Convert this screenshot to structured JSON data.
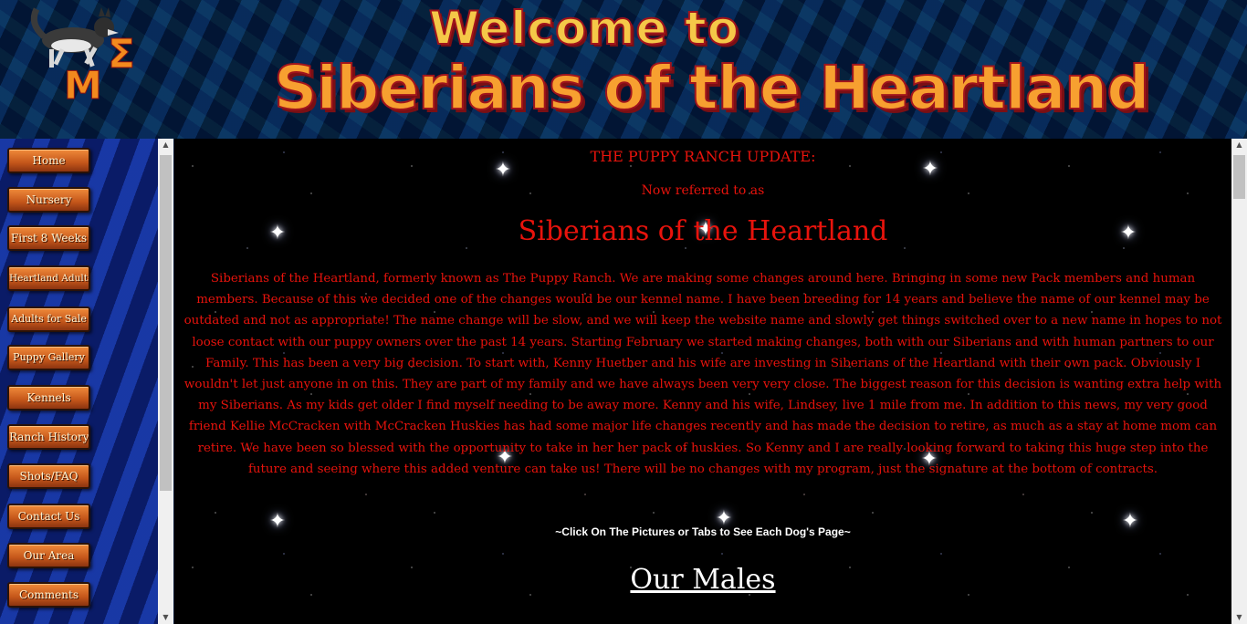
{
  "header": {
    "welcome": "Welcome to",
    "site_name": "Siberians of the Heartland",
    "logo_icon": "husky-logo-icon"
  },
  "nav": {
    "items": [
      {
        "label": "Home"
      },
      {
        "label": "Nursery"
      },
      {
        "label": "First 8 Weeks"
      },
      {
        "label": "Heartland Adults"
      },
      {
        "label": "Adults for Sale"
      },
      {
        "label": "Puppy Gallery"
      },
      {
        "label": "Kennels"
      },
      {
        "label": "Ranch History"
      },
      {
        "label": "Shots/FAQ"
      },
      {
        "label": "Contact Us"
      },
      {
        "label": "Our Area"
      },
      {
        "label": "Comments"
      }
    ]
  },
  "main": {
    "update_title": "THE PUPPY RANCH UPDATE:",
    "referred": "Now referred to as",
    "big_name": "Siberians of the Heartland",
    "body": "Siberians of the Heartland, formerly known as The Puppy Ranch. We are making some changes around here.  Bringing in some new Pack members and human members.  Because of this we decided one of the changes would be our kennel name.  I have been breeding for 14 years and believe the name of our kennel may be outdated and not as appropriate!  The name change will be slow, and we will keep the website name and slowly get things switched over to a new name in hopes to not loose contact with our puppy owners over the past 14 years.  Starting February we started making changes, both with our Siberians and with human partners to our Family.  This has been a very big decision.  To start with, Kenny Huether and his wife are investing in Siberians of the Heartland with their own pack.  Obviously I wouldn't let just anyone in on this.  They are part of my family and we have always been very very close.  The biggest reason for this decision is wanting extra help with my Siberians.  As my kids get older I find myself needing to be away more.  Kenny and his wife, Lindsey,  live 1 mile from me.  In addition to this news, my very good friend Kellie McCracken with McCracken Huskies has had some major life changes recently and has made the decision to retire, as much as a stay at home mom can retire.  We have been so blessed with the opportunity to take in her her pack of huskies.  So Kenny and I are really looking forward to taking this huge step into the future and seeing where this added venture can take us!   There will be no changes with my program, just the signature at the bottom of contracts.",
    "click_note": "~Click On The Pictures or Tabs to See Each Dog's Page~",
    "our_males": "Our Males"
  },
  "colors": {
    "content_text": "#e8130c",
    "content_bg": "#000000",
    "nav_button": "#c4561a"
  }
}
